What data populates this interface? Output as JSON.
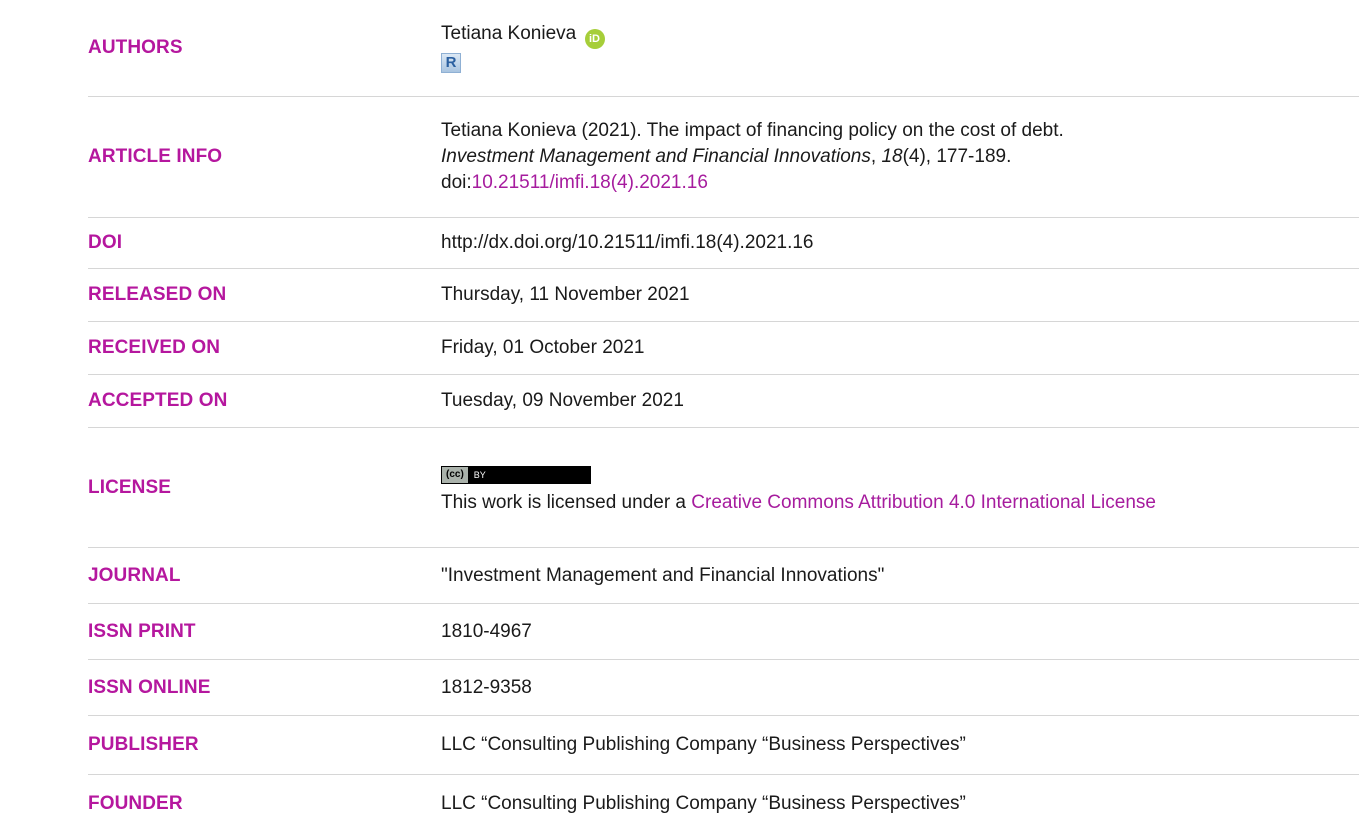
{
  "rows": {
    "authors": {
      "label": "AUTHORS",
      "name": "Tetiana Konieva",
      "orcid_icon": "orcid-icon",
      "researcherid_icon": "researcherid-icon"
    },
    "article_info": {
      "label": "ARTICLE INFO",
      "line1": "Tetiana Konieva (2021). The impact of financing policy on the cost of debt.",
      "journal_italic": "Investment Management and Financial Innovations",
      "sep1": ", ",
      "volume_italic": "18",
      "issue_pages": "(4), 177-189.",
      "doi_prefix": "doi:",
      "doi_link": "10.21511/imfi.18(4).2021.16"
    },
    "doi": {
      "label": "DOI",
      "value": "http://dx.doi.org/10.21511/imfi.18(4).2021.16"
    },
    "released": {
      "label": "RELEASED ON",
      "value": "Thursday, 11 November 2021"
    },
    "received": {
      "label": "RECEIVED ON",
      "value": "Friday, 01 October 2021"
    },
    "accepted": {
      "label": "ACCEPTED ON",
      "value": "Tuesday, 09 November 2021"
    },
    "license": {
      "label": "LICENSE",
      "badge_left": "(cc)",
      "badge_right": "BY",
      "text": "This work is licensed under a ",
      "link": "Creative Commons Attribution 4.0 International License"
    },
    "journal": {
      "label": "JOURNAL",
      "value": "\"Investment Management and Financial Innovations\""
    },
    "issn_print": {
      "label": "ISSN PRINT",
      "value": "1810-4967"
    },
    "issn_online": {
      "label": "ISSN ONLINE",
      "value": "1812-9358"
    },
    "publisher": {
      "label": "PUBLISHER",
      "value": "LLC “Consulting Publishing Company “Business Perspectives”"
    },
    "founder": {
      "label": "FOUNDER",
      "value": "LLC “Consulting Publishing Company “Business Perspectives”"
    }
  },
  "colors": {
    "label": "#b5179e",
    "link": "#a61c9e",
    "divider": "#d6d6d6",
    "orcid": "#a6ce39"
  }
}
